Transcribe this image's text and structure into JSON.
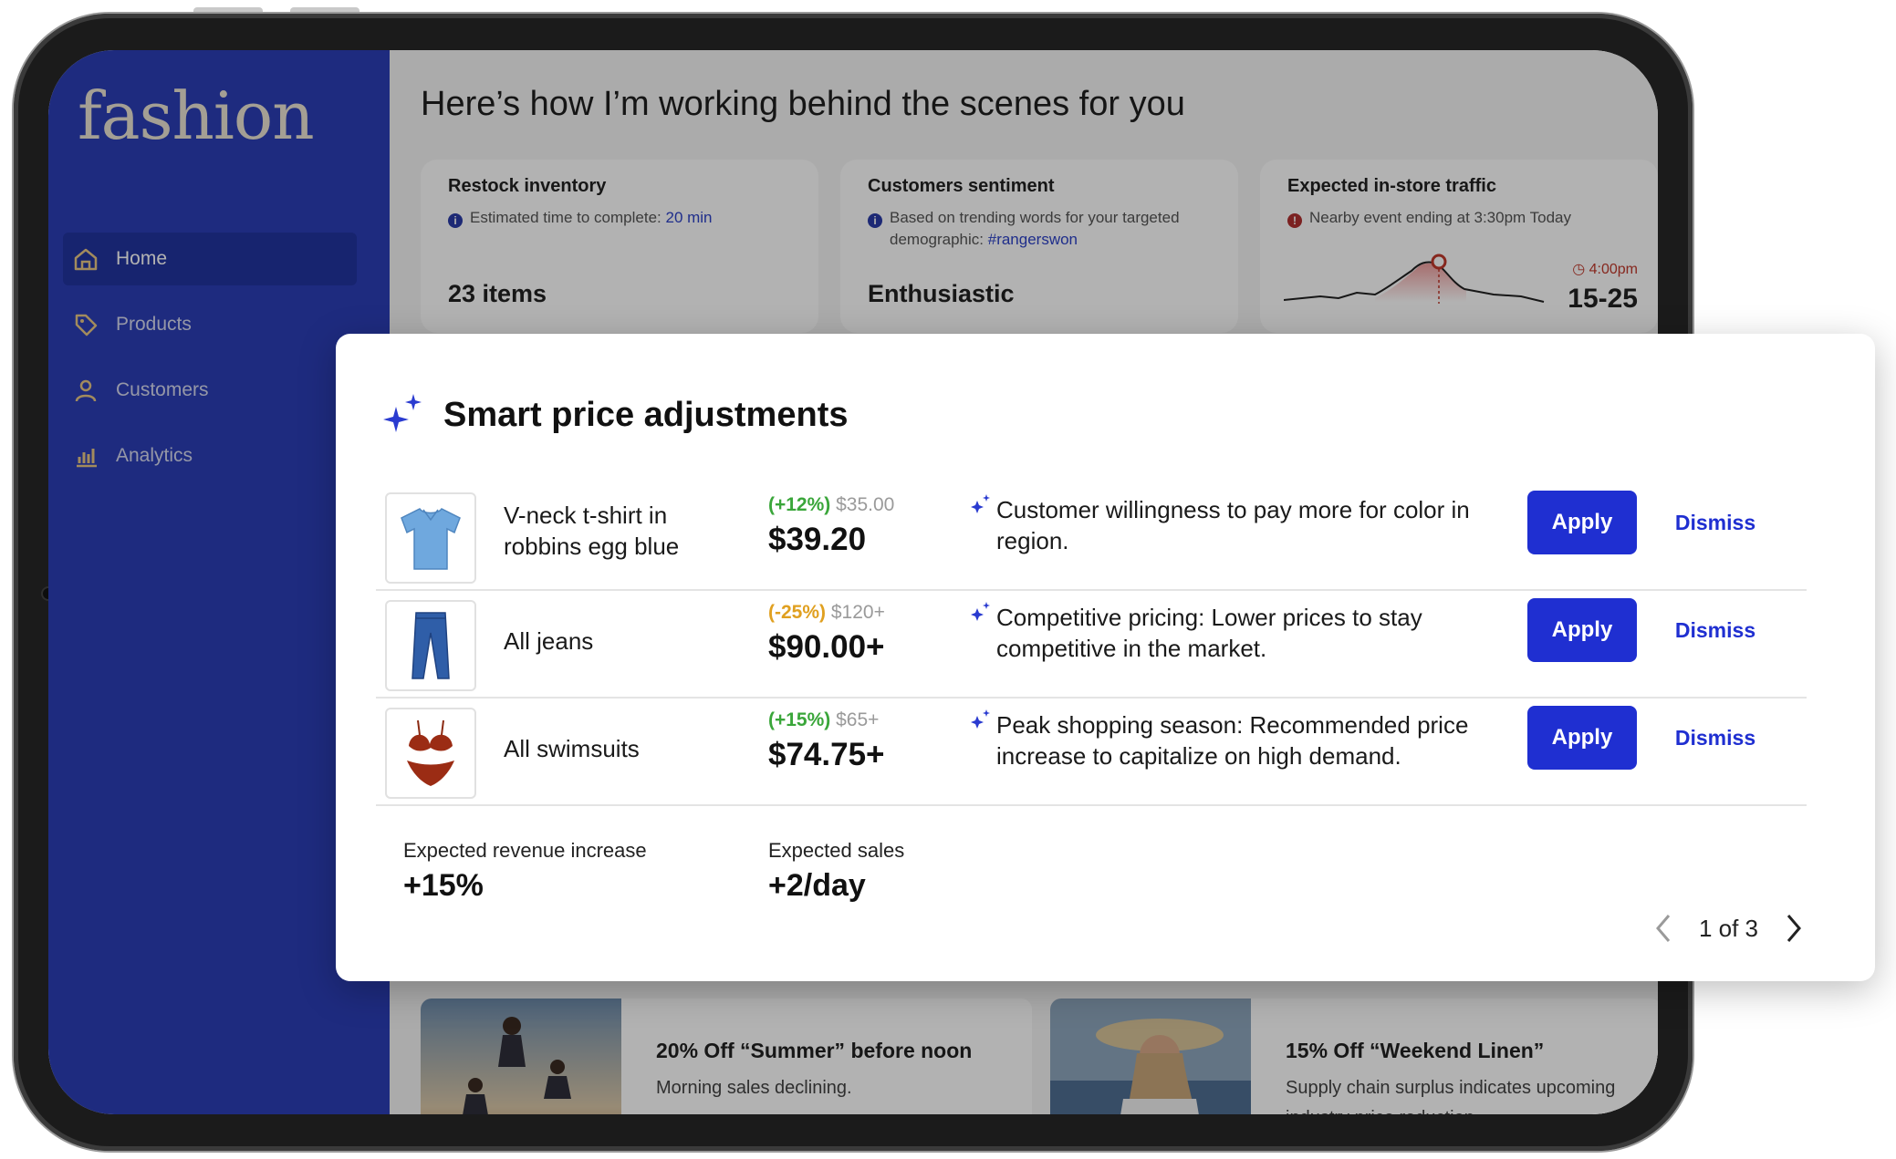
{
  "app": {
    "logo": "fashion"
  },
  "sidebar": {
    "items": [
      {
        "label": "Home",
        "icon": "home-icon",
        "active": true
      },
      {
        "label": "Products",
        "icon": "tag-icon",
        "active": false
      },
      {
        "label": "Customers",
        "icon": "person-icon",
        "active": false
      },
      {
        "label": "Analytics",
        "icon": "bar-chart-icon",
        "active": false
      }
    ]
  },
  "main": {
    "title": "Here’s how I’m working behind the scenes for you",
    "cards": [
      {
        "title": "Restock inventory",
        "note": "Estimated time to complete: ",
        "note_link": "20 min",
        "value": "23 items"
      },
      {
        "title": "Customers sentiment",
        "note": "Based on trending words for your targeted demographic: ",
        "note_link": "#rangerswon",
        "value": "Enthusiastic"
      },
      {
        "title": "Expected in-store traffic",
        "note": "Nearby event ending at 3:30pm Today",
        "time": "4:00pm",
        "value": "15-25"
      }
    ],
    "promos": [
      {
        "title": "20% Off “Summer” before noon",
        "desc": "Morning sales declining."
      },
      {
        "title": "15% Off “Weekend Linen”",
        "desc": "Supply chain surplus indicates upcoming industry price reduction."
      }
    ]
  },
  "modal": {
    "title": "Smart price adjustments",
    "rows": [
      {
        "name": "V-neck t-shirt in robbins egg blue",
        "change_pct": "(+12%)",
        "old_price": "$35.00",
        "new_price": "$39.20",
        "reason": "Customer willingness to pay more for color in region.",
        "apply": "Apply",
        "dismiss": "Dismiss"
      },
      {
        "name": "All jeans",
        "change_pct": "(-25%)",
        "old_price": "$120+",
        "new_price": "$90.00+",
        "reason": "Competitive pricing: Lower prices to stay competitive in the market.",
        "apply": "Apply",
        "dismiss": "Dismiss"
      },
      {
        "name": "All swimsuits",
        "change_pct": "(+15%)",
        "old_price": "$65+",
        "new_price": "$74.75+",
        "reason": "Peak shopping season: Recommended price increase to capitalize on high demand.",
        "apply": "Apply",
        "dismiss": "Dismiss"
      }
    ],
    "metrics": [
      {
        "label": "Expected revenue increase",
        "value": "+15%"
      },
      {
        "label": "Expected sales",
        "value": "+2/day"
      }
    ],
    "pager": "1 of 3"
  },
  "colors": {
    "sidebar": "#2b3eb6",
    "accent": "#1f2fd1",
    "positive": "#3aa63a",
    "negative": "#e0a020"
  }
}
